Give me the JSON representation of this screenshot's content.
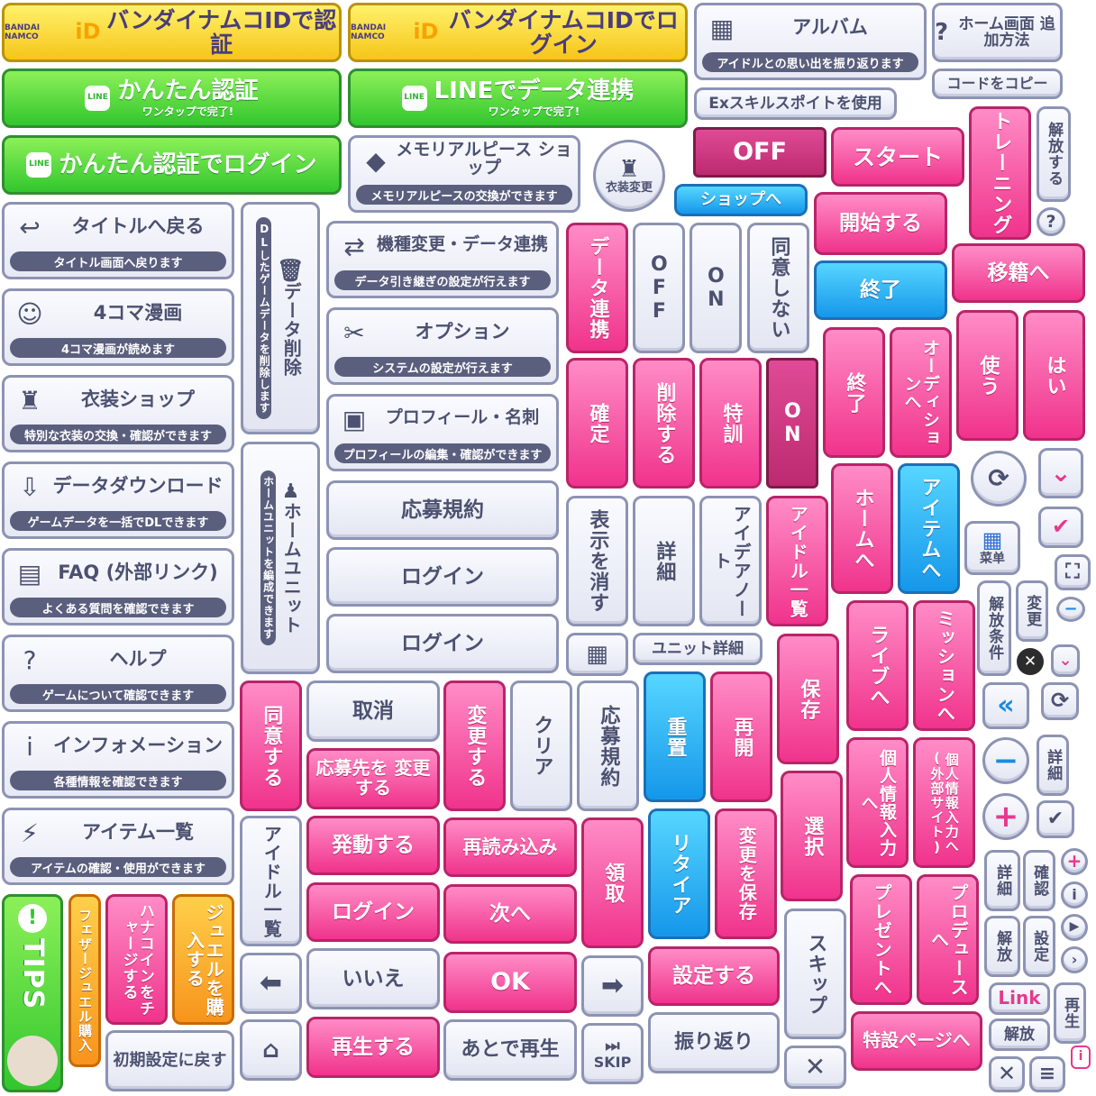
{
  "bandai": {
    "logo_text": "BANDAI NAMCO",
    "logo_id": "iD",
    "auth": "バンダイナムコIDで認証",
    "login": "バンダイナムコIDでログイン"
  },
  "line": {
    "badge": "LINE",
    "kantan_auth": "かんたん認証",
    "link": "LINEでデータ連携",
    "one_tap": "ワンタップで完了!",
    "kantan_login": "かんたん認証でログイン"
  },
  "album": {
    "title": "アルバム",
    "sub": "アイドルとの思い出を振り返ります"
  },
  "home_screen": "ホーム画面 追加方法",
  "copy_code": "コードをコピー",
  "ex_skill": "Exスキルスポイトを使用",
  "memorial": {
    "title": "メモリアルピース ショップ",
    "sub": "メモリアルピースの交換ができます"
  },
  "costume_change": "衣装変更",
  "shop_to": "ショップへ",
  "menu": [
    {
      "title": "タイトルへ戻る",
      "sub": "タイトル画面へ戻ります",
      "icon": "↩"
    },
    {
      "title": "4コマ漫画",
      "sub": "4コマ漫画が読めます",
      "icon": "☺"
    },
    {
      "title": "衣装ショップ",
      "sub": "特別な衣装の交換・確認ができます",
      "icon": "♜"
    },
    {
      "title": "データダウンロード",
      "sub": "ゲームデータを一括でDLできます",
      "icon": "⇩"
    },
    {
      "title": "FAQ (外部リンク)",
      "sub": "よくある質問を確認できます",
      "icon": "▤"
    },
    {
      "title": "ヘルプ",
      "sub": "ゲームについて確認できます",
      "icon": "?"
    },
    {
      "title": "インフォメーション",
      "sub": "各種情報を確認できます",
      "icon": "i"
    },
    {
      "title": "アイテム一覧",
      "sub": "アイテムの確認・使用ができます",
      "icon": "⚡"
    }
  ],
  "menu2": [
    {
      "title": "機種変更・データ連携",
      "sub": "データ引き継ぎの設定が行えます",
      "icon": "⇄"
    },
    {
      "title": "オプション",
      "sub": "システムの設定が行えます",
      "icon": "✂"
    },
    {
      "title": "プロフィール・名刺",
      "sub": "プロフィールの編集・確認ができます",
      "icon": "▣"
    }
  ],
  "data_delete": {
    "title": "データ削除",
    "sub": "DLしたゲームデータを削除します"
  },
  "home_unit": {
    "title": "ホームユニット",
    "sub": "ホームユニットを編成できます"
  },
  "labels": {
    "off": "OFF",
    "start": "スタート",
    "training": "トレーニング",
    "unlock": "解放する",
    "help_q": "?",
    "begin": "開始する",
    "finish": "終了",
    "transfer": "移籍へ",
    "data_link": "データ連携",
    "off_v": "OFF",
    "on_v": "ON",
    "disagree": "同意しない",
    "finish_v": "終了",
    "audition": "オーディションへ",
    "use": "使う",
    "yes": "はい",
    "confirm": "確定",
    "delete": "削除する",
    "special": "特訓",
    "on_dark": "ON",
    "home_to": "ホームへ",
    "items_to": "アイテムへ",
    "menu": "菜单",
    "apply_rules": "応募規約",
    "login1": "ログイン",
    "login2": "ログイン",
    "hide": "表示を消す",
    "detail": "詳細",
    "idea_note": "アイデアノート",
    "idol_list": "アイドル一覧",
    "unit_detail": "ユニット詳細",
    "unlock_cond": "解放条件",
    "change": "変更",
    "live": "ライブへ",
    "mission": "ミッションへ",
    "save": "保存",
    "agree": "同意する",
    "cancel": "取消",
    "change_apply": "応募先を 変更する",
    "change_do": "変更する",
    "clear": "クリア",
    "apply_rules_v": "応募規約",
    "overlap": "重置",
    "resume": "再開",
    "personal": "個人情報入力へ",
    "personal_ext": "個人情報入力へ(外部サイト)",
    "detail2": "詳細",
    "choose": "選択",
    "activate": "発動する",
    "reload": "再読み込み",
    "receive": "領取",
    "retire": "リタイア",
    "save_change": "変更を保存",
    "idol_list_v": "アイドル一覧",
    "login3": "ログイン",
    "next": "次へ",
    "present": "プレゼントへ",
    "produce": "プロデュースへ",
    "detail3": "詳細",
    "check": "確認",
    "unlock2": "解放",
    "settings": "設定",
    "tips": "TIPS",
    "feather": "フェザージュエル購入",
    "charge": "ハナコインをチャージする",
    "jewel": "ジュエルを購入する",
    "no": "いいえ",
    "ok": "OK",
    "do_settings": "設定する",
    "skip_v": "スキップ",
    "link": "Link",
    "replay": "再生",
    "reset": "初期設定に戻す",
    "play": "再生する",
    "play_later": "あとで再生",
    "skip": "SKIP",
    "look_back": "振り返り",
    "special_page": "特設ページへ",
    "unlock3": "解放"
  },
  "colors": {
    "pink": "#f0338c",
    "blue": "#1597ea",
    "green": "#32c62e",
    "yellow": "#f6c51a",
    "gray": "#e3e6f2"
  }
}
